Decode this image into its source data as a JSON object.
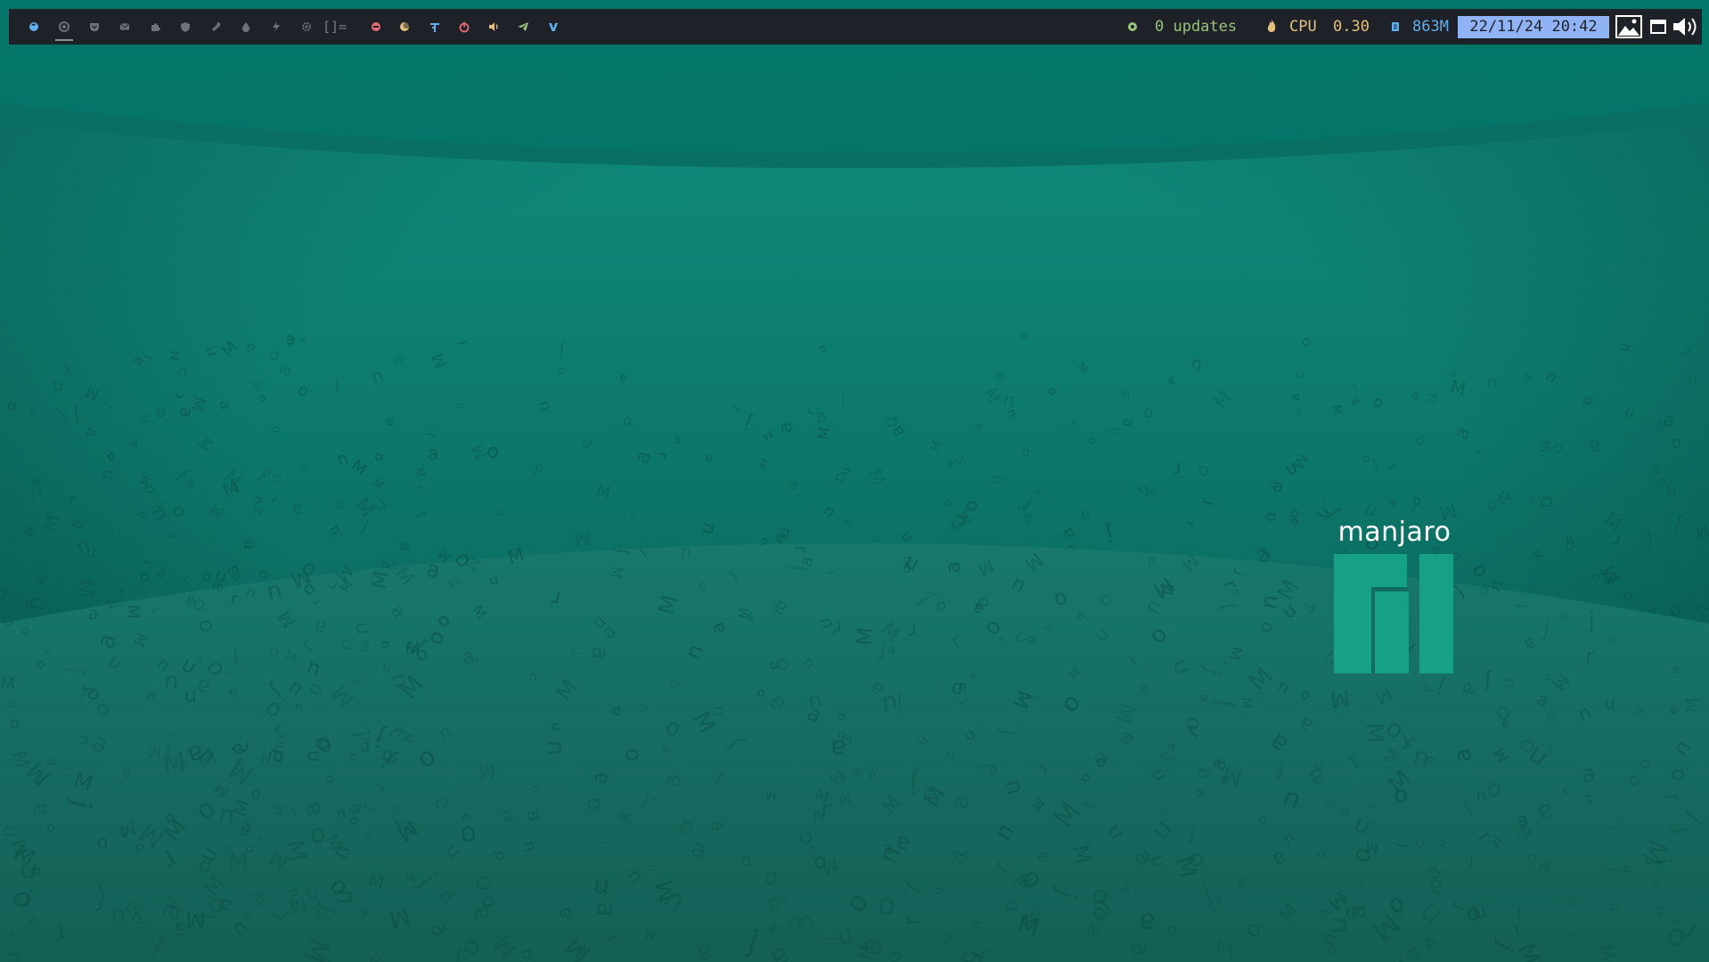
{
  "colors": {
    "bar_bg": "#1e2127",
    "wallpaper_top": "#05766a",
    "wallpaper_floor": "#166b5f",
    "logo_green": "#16a085",
    "updates_green": "#98c379",
    "cpu_yellow": "#e5c07b",
    "mem_blue": "#61afef",
    "clock_bg": "#8fb3f5"
  },
  "workspaces": [
    {
      "icon": "firefox-icon",
      "active": false,
      "color": "#61afef"
    },
    {
      "icon": "chrome-icon",
      "active": true,
      "color": "#6e7179"
    },
    {
      "icon": "pocket-icon",
      "active": false,
      "color": "#6e7179"
    },
    {
      "icon": "mail-icon",
      "active": false,
      "color": "#6e7179"
    },
    {
      "icon": "puzzle-icon",
      "active": false,
      "color": "#6e7179"
    },
    {
      "icon": "shield-icon",
      "active": false,
      "color": "#6e7179"
    },
    {
      "icon": "wrench-icon",
      "active": false,
      "color": "#6e7179"
    },
    {
      "icon": "droplet-icon",
      "active": false,
      "color": "#6e7179"
    },
    {
      "icon": "bolt-icon",
      "active": false,
      "color": "#6e7179"
    },
    {
      "icon": "gear-icon",
      "active": false,
      "color": "#6e7179"
    }
  ],
  "layout_symbol": "[]=",
  "tray": [
    {
      "icon": "no-entry-icon",
      "color": "#e06c75"
    },
    {
      "icon": "moon-icon",
      "color": "#e5c07b"
    },
    {
      "icon": "network-icon",
      "color": "#61afef"
    },
    {
      "icon": "power-icon",
      "color": "#e06c75"
    },
    {
      "icon": "speaker-icon",
      "color": "#e5c07b"
    },
    {
      "icon": "telegram-icon",
      "color": "#98c379"
    },
    {
      "icon": "vivaldi-icon",
      "color": "#61afef"
    }
  ],
  "status": {
    "updates_icon": "circle-icon",
    "updates_text": "0 updates",
    "cpu_icon": "flame-icon",
    "cpu_label": "CPU",
    "cpu_value": "0.30",
    "mem_icon": "memory-icon",
    "mem_value": "863M",
    "datetime": "22/11/24 20:42"
  },
  "system_icons": [
    "image-icon",
    "window-icon",
    "volume-icon"
  ],
  "logo": {
    "text": "manjaro"
  }
}
